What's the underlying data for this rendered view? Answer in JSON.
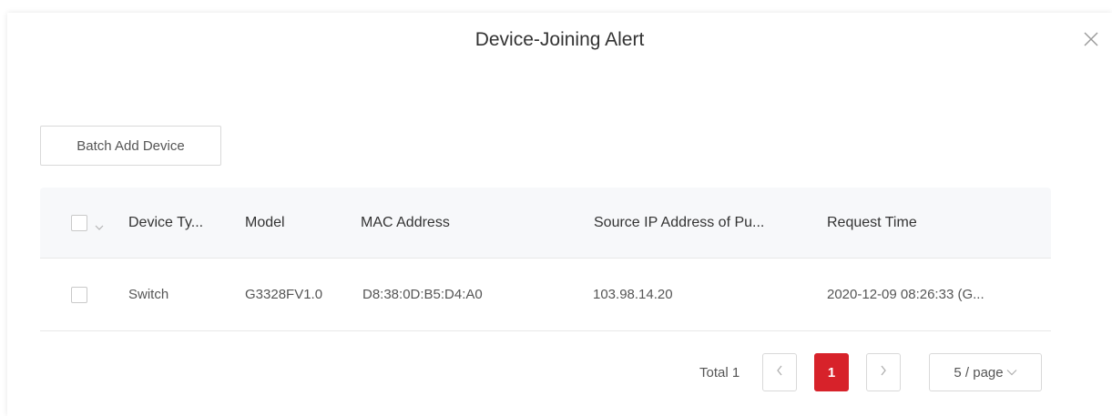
{
  "dialog": {
    "title": "Device-Joining Alert"
  },
  "toolbar": {
    "batch_add_label": "Batch Add Device"
  },
  "table": {
    "columns": [
      "Device Ty...",
      "Model",
      "MAC Address",
      "Source IP Address of Pu...",
      "Request Time"
    ],
    "rows": [
      {
        "device_type": "Switch",
        "model": "G3328FV1.0",
        "mac": "D8:38:0D:B5:D4:A0",
        "source_ip": "103.98.14.20",
        "request_time": "2020-12-09 08:26:33 (G..."
      }
    ]
  },
  "pagination": {
    "total_label": "Total 1",
    "prev_icon": "chevron-left-icon",
    "current_page": "1",
    "next_icon": "chevron-right-icon",
    "page_size_label": "5 / page"
  },
  "colors": {
    "accent": "#d7222a",
    "header_bg": "#f7f8fa",
    "border": "#d9d9d9"
  }
}
